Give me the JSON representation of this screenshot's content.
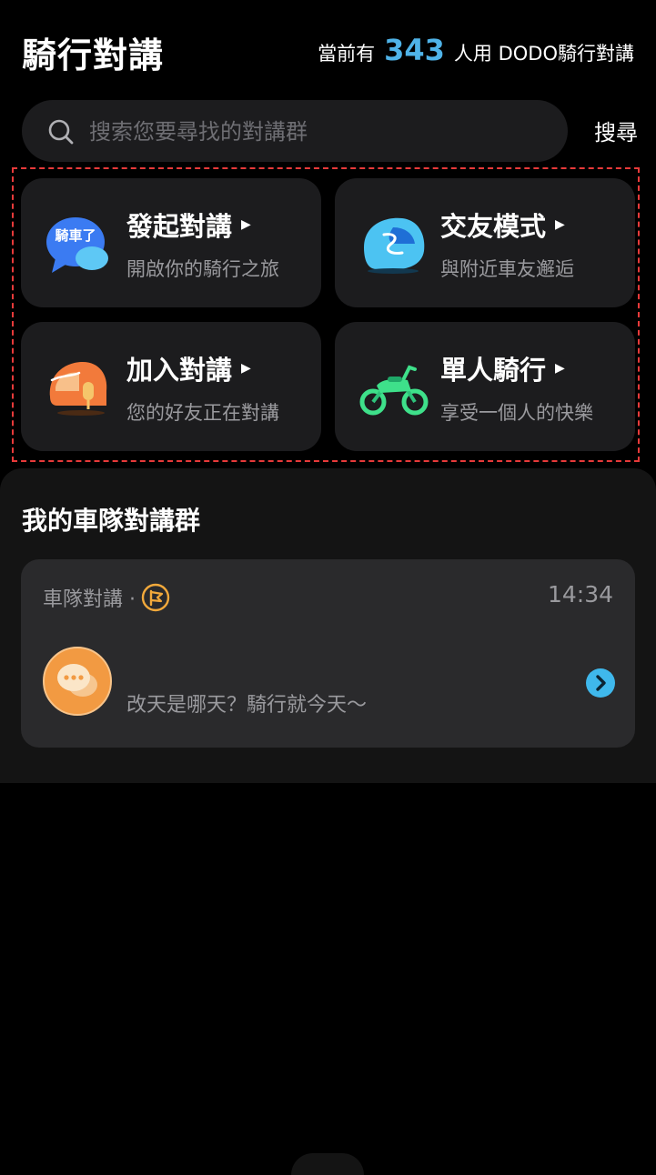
{
  "header": {
    "title": "騎行對講",
    "online_prefix": "當前有",
    "online_count": "343",
    "online_suffix": "人用 DODO騎行對講"
  },
  "search": {
    "placeholder": "搜索您要尋找的對講群",
    "button_label": "搜尋"
  },
  "features": [
    {
      "title": "發起對講",
      "subtitle": "開啟你的騎行之旅",
      "icon": "chat-bubble-icon",
      "icon_text": "騎車了"
    },
    {
      "title": "交友模式",
      "subtitle": "與附近車友邂逅",
      "icon": "blue-helmet-icon"
    },
    {
      "title": "加入對講",
      "subtitle": "您的好友正在對講",
      "icon": "orange-helmet-mic-icon"
    },
    {
      "title": "單人騎行",
      "subtitle": "享受一個人的快樂",
      "icon": "motorcycle-icon"
    }
  ],
  "team": {
    "section_title": "我的車隊對講群",
    "card_label": "車隊對講 ·",
    "time": "14:34",
    "message": "改天是哪天？騎行就今天～"
  },
  "colors": {
    "accent_blue": "#4fb3e8",
    "highlight_frame": "#e83a3a",
    "card_bg": "#1c1c1e",
    "flag_orange": "#f2a93b"
  }
}
